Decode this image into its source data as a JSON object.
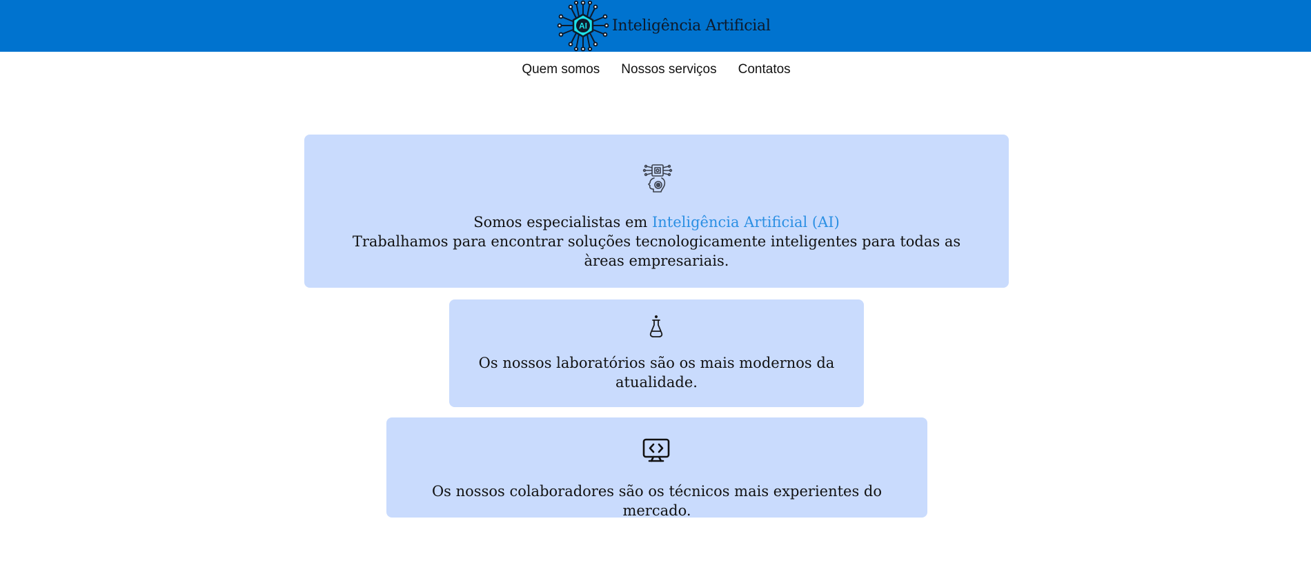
{
  "header": {
    "logo_text": "AI",
    "title": "Inteligência Artificial",
    "background": "#0073cf"
  },
  "nav": {
    "items": [
      {
        "label": "Quem somos"
      },
      {
        "label": "Nossos serviços"
      },
      {
        "label": "Contatos"
      }
    ]
  },
  "cards": [
    {
      "icon": "ai-head-icon",
      "lead": "Somos especialistas em ",
      "highlight": "Inteligência Artificial (AI)",
      "body": "Trabalhamos para encontrar soluções tecnologicamente inteligentes para todas as àreas empresariais."
    },
    {
      "icon": "flask-icon",
      "body": "Os nossos laboratórios são os mais modernos da atualidade."
    },
    {
      "icon": "monitor-code-icon",
      "body": "Os nossos colaboradores são os técnicos mais experientes do mercado."
    }
  ],
  "colors": {
    "card_background": "#c9dbfd",
    "highlight": "#2b8fe3",
    "logo_hex": "#1de0e8"
  }
}
